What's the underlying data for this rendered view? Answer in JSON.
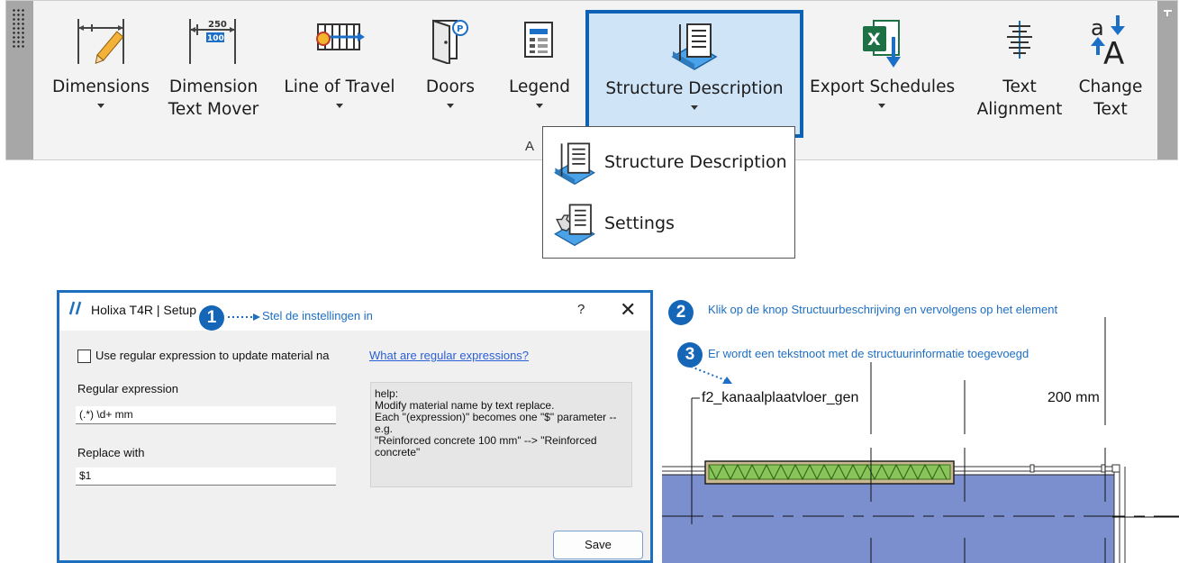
{
  "ribbon": {
    "buttons": [
      {
        "label_1": "Dimensions",
        "label_2": "",
        "icon": "dimension-pencil-icon",
        "has_arrow": true
      },
      {
        "label_1": "Dimension",
        "label_2": "Text Mover",
        "icon": "dimension-text-mover-icon",
        "has_arrow": false
      },
      {
        "label_1": "Line of Travel",
        "label_2": "",
        "icon": "line-of-travel-icon",
        "has_arrow": true
      },
      {
        "label_1": "Doors",
        "label_2": "",
        "icon": "door-icon",
        "has_arrow": true
      },
      {
        "label_1": "Legend",
        "label_2": "",
        "icon": "legend-icon",
        "has_arrow": true
      },
      {
        "label_1": "Structure Description",
        "label_2": "",
        "icon": "structure-description-icon",
        "has_arrow": true
      },
      {
        "label_1": "Export Schedules",
        "label_2": "",
        "icon": "excel-export-icon",
        "has_arrow": true
      },
      {
        "label_1": "Text",
        "label_2": "Alignment",
        "icon": "text-alignment-icon",
        "has_arrow": false
      },
      {
        "label_1": "Change",
        "label_2": "Text",
        "icon": "change-text-icon",
        "has_arrow": false
      }
    ],
    "panel_letter": "A"
  },
  "dropdown": {
    "items": [
      {
        "label": "Structure Description",
        "icon": "structure-description-icon"
      },
      {
        "label": "Settings",
        "icon": "settings-icon"
      }
    ]
  },
  "dialog": {
    "title": "Holixa T4R | Setup",
    "help_symbol": "?",
    "close_symbol": "✕",
    "checkbox_label": "Use regular expression to update material na",
    "link_text": "What are regular expressions?",
    "regex_label": "Regular expression",
    "regex_value": "(.*) \\d+ mm",
    "replace_label": "Replace with",
    "replace_value": "$1",
    "help_text": "help:\nModify material name by text replace.\nEach \"(expression)\" becomes one \"$\" parameter --\ne.g.\n\"Reinforced concrete 100 mm\" --> \"Reinforced\nconcrete\"",
    "save_label": "Save"
  },
  "callouts": [
    {
      "number": "1",
      "text": "Stel de instellingen in"
    },
    {
      "number": "2",
      "text": "Klik op de knop Structuurbeschrijving en vervolgens op het element"
    },
    {
      "number": "3",
      "text": "Er wordt een tekstnoot met de structuurinformatie toegevoegd"
    }
  ],
  "drawing": {
    "note_text": "f2_kanaalplaatvloer_gen",
    "dimension_text": "200 mm",
    "colors": {
      "slab": "#7b8fcf",
      "element": "#88c45a",
      "callout": "#1566b7"
    }
  }
}
